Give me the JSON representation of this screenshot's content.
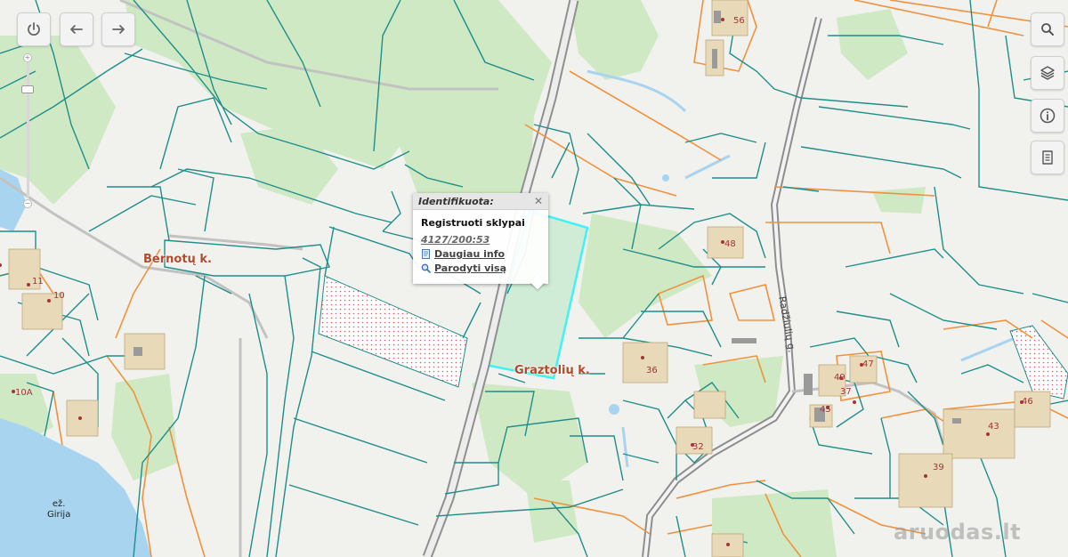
{
  "map": {
    "colors": {
      "background": "#f1f1ee",
      "forest": "#cfe9c4",
      "forest_dark": "#b7dcaa",
      "parcel_line": "#1f8e8a",
      "cadastral_line": "#f0923d",
      "water": "#a8d4f0",
      "road": "#b0b0b0",
      "selected_outline": "#3ff2f5",
      "hatch": "#e2595e"
    },
    "places": {
      "bernotu": "Bernotų k.",
      "graztoliu": "Graztolių k."
    },
    "road_name": "Radžiulių g.",
    "lake": {
      "line1": "ež.",
      "line2": "Girija"
    },
    "house_numbers": {
      "n56": "56",
      "n48": "48",
      "n36": "36",
      "n11": "11",
      "n10": "10",
      "n10a": "10A",
      "n47": "47",
      "n49": "49",
      "n37": "37",
      "n45": "45",
      "n46": "46",
      "n43": "43",
      "n39": "39",
      "n32": "32"
    }
  },
  "controls": {
    "left": [
      "power-icon",
      "arrow-left-icon",
      "arrow-right-icon"
    ],
    "right": [
      "search-icon",
      "layers-icon",
      "info-icon",
      "document-icon"
    ],
    "zoom_slider": {
      "plus": "+",
      "minus": "−"
    }
  },
  "popup": {
    "title": "Identifikuota:",
    "close": "✕",
    "layer": "Registruoti sklypai",
    "parcel": "4127/200:53",
    "more_info": "Daugiau info",
    "show_all": "Parodyti visą"
  },
  "watermark": "aruodas.lt"
}
